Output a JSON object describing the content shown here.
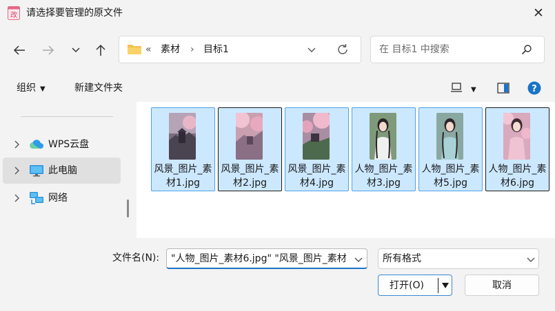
{
  "window": {
    "title": "请选择要管理的原文件"
  },
  "navigation": {
    "breadcrumb": {
      "overflow": "«",
      "crumbs": [
        "素材",
        "目标1"
      ]
    },
    "search": {
      "placeholder": "在 目标1 中搜索"
    }
  },
  "toolbar": {
    "organize": "组织",
    "new_folder": "新建文件夹"
  },
  "sidebar": {
    "items": [
      {
        "label": "WPS云盘",
        "icon": "cloud-icon",
        "selected": false
      },
      {
        "label": "此电脑",
        "icon": "monitor-icon",
        "selected": true
      },
      {
        "label": "网络",
        "icon": "network-icon",
        "selected": false
      }
    ]
  },
  "files": [
    {
      "name": "风景_图片_素材1.jpg",
      "thumbnail": "landscape-thumbnail",
      "focused": false
    },
    {
      "name": "风景_图片_素材2.jpg",
      "thumbnail": "landscape-thumbnail",
      "focused": true
    },
    {
      "name": "风景_图片_素材4.jpg",
      "thumbnail": "landscape-thumbnail",
      "focused": false
    },
    {
      "name": "人物_图片_素材3.jpg",
      "thumbnail": "portrait-thumbnail",
      "focused": false
    },
    {
      "name": "人物_图片_素材5.jpg",
      "thumbnail": "portrait-thumbnail",
      "focused": false
    },
    {
      "name": "人物_图片_素材6.jpg",
      "thumbnail": "portrait-thumbnail",
      "focused": true
    }
  ],
  "bottom": {
    "filename_label": "文件名(N):",
    "filename_value": "\"人物_图片_素材6.jpg\" \"风景_图片_素材",
    "filetype_value": "所有格式",
    "open_label": "打开(O)",
    "cancel_label": "取消"
  },
  "colors": {
    "accent": "#1a73c8",
    "selection": "#cce8ff",
    "selection_border": "#4ea1e6",
    "help": "#1a73c8"
  }
}
